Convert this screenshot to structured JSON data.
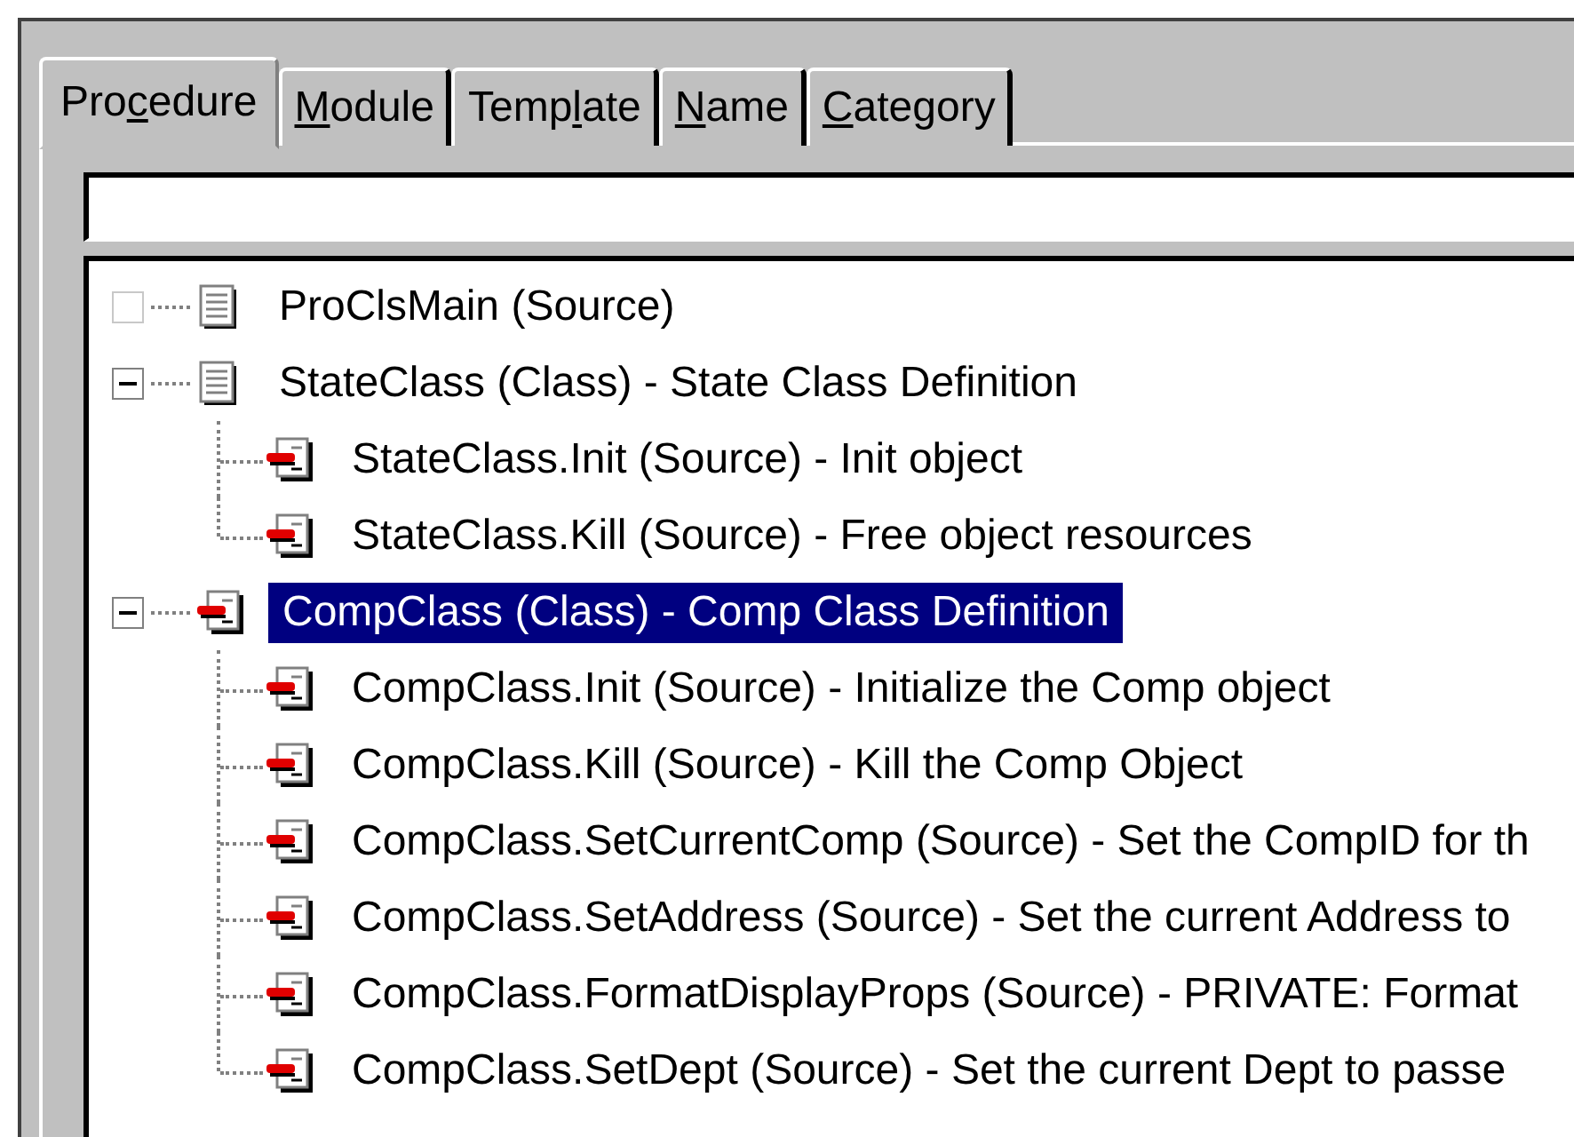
{
  "tabs": [
    {
      "label_pre": "Pro",
      "access_key": "c",
      "label_post": "edure",
      "selected": true
    },
    {
      "access_key": "M",
      "label_post": "odule",
      "selected": false
    },
    {
      "label_pre": "Temp",
      "access_key": "l",
      "label_post": "ate",
      "selected": false
    },
    {
      "access_key": "N",
      "label_post": "ame",
      "selected": false
    },
    {
      "access_key": "C",
      "label_post": "ategory",
      "selected": false
    }
  ],
  "tree": [
    {
      "text": "ProClsMain (Source)",
      "kind": "page",
      "selected": false
    },
    {
      "text": "StateClass (Class) - State Class Definition",
      "kind": "page",
      "selected": false,
      "expanded": true,
      "children": [
        {
          "text": "StateClass.Init (Source) - Init object",
          "kind": "method",
          "selected": false
        },
        {
          "text": "StateClass.Kill (Source) - Free object resources",
          "kind": "method",
          "selected": false
        }
      ]
    },
    {
      "text": "CompClass (Class) - Comp Class Definition",
      "kind": "method",
      "selected": true,
      "expanded": true,
      "children": [
        {
          "text": "CompClass.Init (Source) - Initialize the Comp object",
          "kind": "method",
          "selected": false
        },
        {
          "text": "CompClass.Kill (Source) - Kill the Comp Object",
          "kind": "method",
          "selected": false
        },
        {
          "text": "CompClass.SetCurrentComp (Source) - Set the CompID for th",
          "kind": "method",
          "selected": false
        },
        {
          "text": "CompClass.SetAddress (Source) - Set the current Address to",
          "kind": "method",
          "selected": false
        },
        {
          "text": "CompClass.FormatDisplayProps (Source) - PRIVATE: Format",
          "kind": "method",
          "selected": false
        },
        {
          "text": "CompClass.SetDept (Source) - Set the current Dept to passe",
          "kind": "method",
          "selected": false
        }
      ]
    }
  ]
}
